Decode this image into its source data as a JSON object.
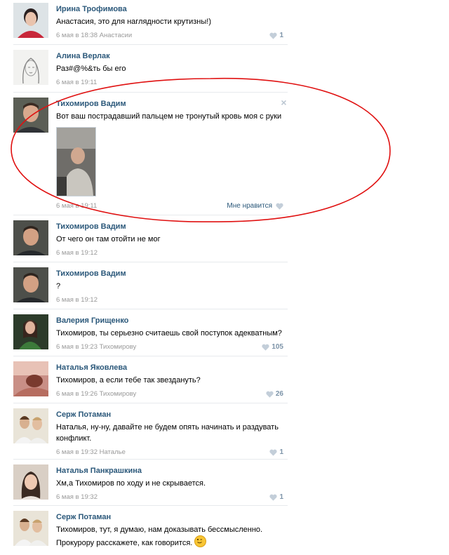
{
  "comments": [
    {
      "author": "Ирина Трофимова",
      "text": "Анастасия, это для наглядности крутизны!)",
      "date": "6 мая в 18:38",
      "reply_to": "Анастасии",
      "likes": "1"
    },
    {
      "author": "Алина Верлак",
      "text": "Раз#@%&ть бы его",
      "date": "6 мая в 19:11",
      "reply_to": "",
      "likes": ""
    },
    {
      "author": "Тихомиров Вадим",
      "text": "Вот ваш пострадавший пальцем не тронутый кровь моя с руки",
      "date": "6 мая в 19:11",
      "reply_to": "",
      "likes": "",
      "like_label": "Мне нравится"
    },
    {
      "author": "Тихомиров Вадим",
      "text": "От чего он там отойти не мог",
      "date": "6 мая в 19:12",
      "reply_to": "",
      "likes": ""
    },
    {
      "author": "Тихомиров Вадим",
      "text": "?",
      "date": "6 мая в 19:12",
      "reply_to": "",
      "likes": ""
    },
    {
      "author": "Валерия Грищенко",
      "text": "Тихомиров, ты серьезно считаешь свой поступок адекватным?",
      "date": "6 мая в 19:23",
      "reply_to": "Тихомирову",
      "likes": "105"
    },
    {
      "author": "Наталья Яковлева",
      "text": "Тихомиров, а если тебе так звездануть?",
      "date": "6 мая в 19:26",
      "reply_to": "Тихомирову",
      "likes": "26"
    },
    {
      "author": "Серж Потаман",
      "text": "Наталья, ну-ну, давайте не будем опять начинать и раздувать конфликт.",
      "date": "6 мая в 19:32",
      "reply_to": "Наталье",
      "likes": "1"
    },
    {
      "author": "Наталья Панкрашкина",
      "text": "Хм,а Тихомиров по ходу и не скрывается.",
      "date": "6 мая в 19:32",
      "reply_to": "",
      "likes": "1"
    },
    {
      "author": "Серж Потаман",
      "text": "Тихомиров, тут, я думаю, нам доказывать бессмысленно. Прокурору расскажете, как говорится.",
      "date": "",
      "reply_to": "",
      "likes": ""
    }
  ],
  "colors": {
    "link": "#2b587a",
    "meta": "#999999",
    "highlight_ellipse": "#e01010",
    "likes": "#7c93a8"
  },
  "icons": {
    "like": "heart-icon",
    "delete": "close-icon",
    "emoji": "wink-smiley-icon"
  }
}
